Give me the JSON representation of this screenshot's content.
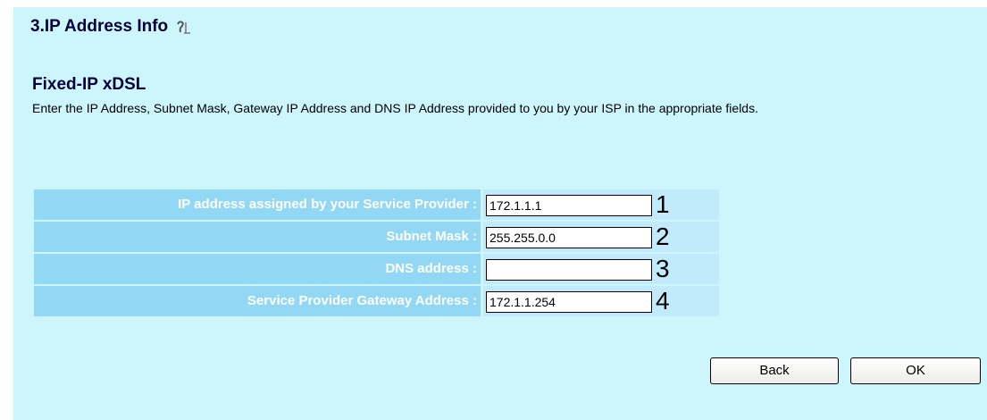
{
  "section": {
    "title": "3.IP Address Info",
    "help_icon": "help-icon"
  },
  "subtitle": "Fixed-IP xDSL",
  "description": "Enter the IP Address, Subnet Mask, Gateway IP Address and DNS IP Address provided to you by your ISP in the appropriate fields.",
  "form": {
    "rows": [
      {
        "label": "IP address assigned by your Service Provider :",
        "value": "172.1.1.1",
        "marker": "1"
      },
      {
        "label": "Subnet Mask :",
        "value": "255.255.0.0",
        "marker": "2"
      },
      {
        "label": "DNS address :",
        "value": "",
        "marker": "3"
      },
      {
        "label": "Service Provider Gateway Address :",
        "value": "172.1.1.254",
        "marker": "4"
      }
    ]
  },
  "buttons": {
    "back": "Back",
    "ok": "OK"
  },
  "colors": {
    "panel": "#ccf6fb",
    "label_cell": "#92d8f5",
    "value_cell": "#c1ebfb",
    "title": "#00003a"
  }
}
